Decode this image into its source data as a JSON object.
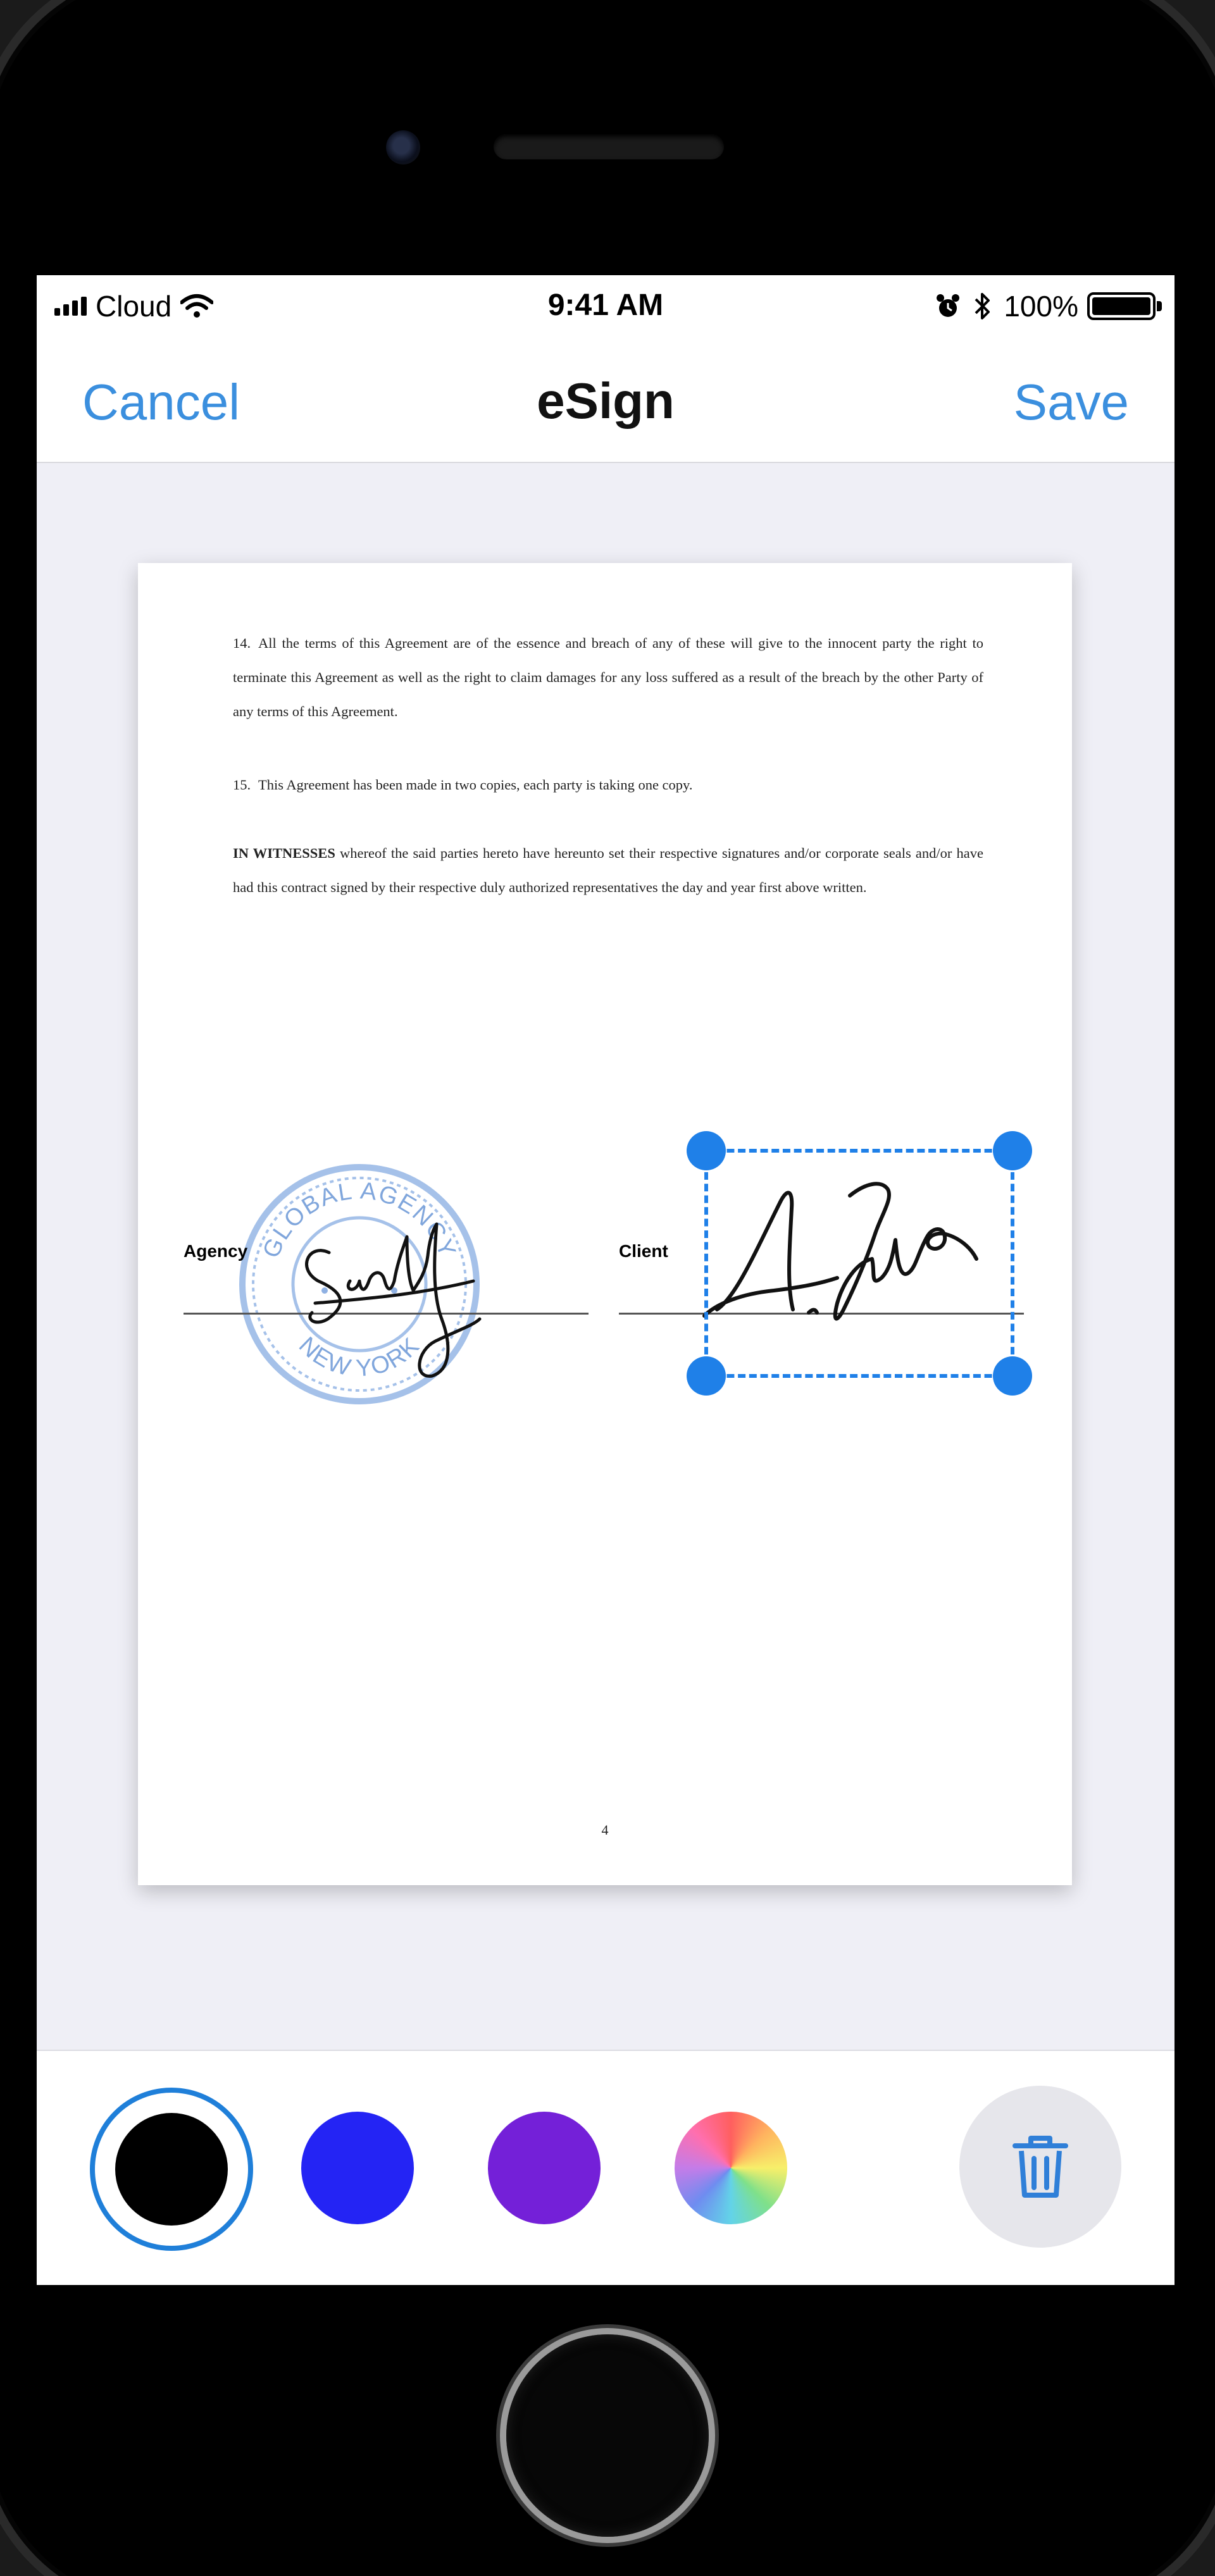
{
  "status_bar": {
    "carrier": "Cloud",
    "time": "9:41 AM",
    "battery": "100%",
    "icons": [
      "signal-icon",
      "wifi-icon",
      "alarm-icon",
      "bluetooth-icon",
      "battery-icon"
    ]
  },
  "nav": {
    "cancel_label": "Cancel",
    "title": "eSign",
    "save_label": "Save"
  },
  "document": {
    "clause_14_num": "14.",
    "clause_14_text": "All the terms of this Agreement are of the essence and breach of any of these will give to the innocent party the right to terminate this Agreement as well as the right to claim damages for any loss suffered as a result of the breach by the other Party of any terms of this Agreement.",
    "clause_15_num": "15.",
    "clause_15_text": "This Agreement has been made in two copies, each party is taking one copy.",
    "witness_bold": "IN WITNESSES",
    "witness_text": " whereof the said parties hereto have hereunto set their respective signatures and/or corporate seals and/or have had this contract signed by their respective duly authorized representatives the day and year first above written.",
    "agency_label": "Agency",
    "client_label": "Client",
    "seal_text_top": "GLOBAL AGENCY",
    "seal_text_bottom": "NEW YORK",
    "page_number": "4"
  },
  "toolbar": {
    "colors": {
      "black": "#000000",
      "blue": "#2424f4",
      "purple": "#7420d8",
      "rainbow": "color-wheel"
    },
    "selected_color": "black",
    "accent": "#1f7fd9",
    "delete_icon": "trash-icon"
  }
}
